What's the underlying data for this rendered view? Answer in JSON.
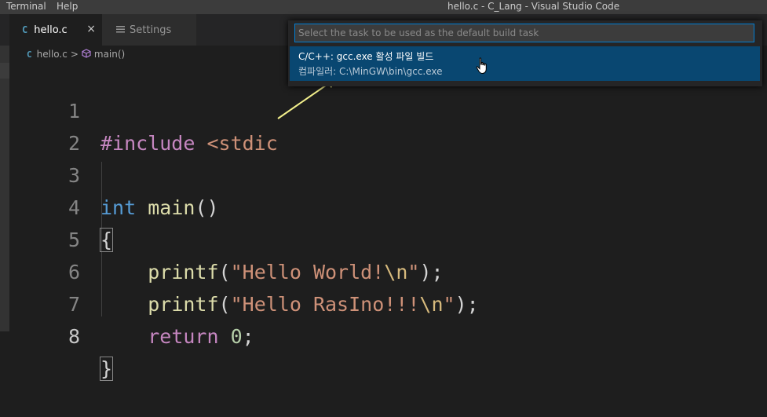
{
  "menubar": {
    "items": [
      "Terminal",
      "Help"
    ],
    "window_title": "hello.c - C_Lang - Visual Studio Code"
  },
  "tabs": [
    {
      "icon": "C",
      "label": "hello.c",
      "close": "×",
      "active": true
    },
    {
      "icon": "settings-icon",
      "label": "Settings",
      "active": false
    }
  ],
  "breadcrumb": {
    "file_icon": "C",
    "file": "hello.c",
    "separator": ">",
    "symbol_icon": "cube-icon",
    "symbol": "main()"
  },
  "editor": {
    "line_numbers": [
      "1",
      "2",
      "3",
      "4",
      "5",
      "6",
      "7",
      "8"
    ],
    "current_line": "8",
    "tokens": {
      "l1_pre": "#include",
      "l1_rest": " <stdic",
      "l3_type": "int",
      "l3_fn": "main",
      "l3_paren": "()",
      "l4_brace": "{",
      "l5_fn": "printf",
      "l5_open": "(",
      "l5_str": "\"Hello World!",
      "l5_esc": "\\n",
      "l5_strend": "\"",
      "l5_close": ");",
      "l6_fn": "printf",
      "l6_open": "(",
      "l6_str": "\"Hello RasIno!!!",
      "l6_esc": "\\n",
      "l6_strend": "\"",
      "l6_close": ");",
      "l7_kw": "return",
      "l7_num": "0",
      "l7_semi": ";",
      "l8_brace": "}"
    }
  },
  "quick_pick": {
    "placeholder": "Select the task to be used as the default build task",
    "items": [
      {
        "label": "C/C++: gcc.exe 활성 파일 빌드",
        "detail": "컴파일러: C:\\MinGW\\bin\\gcc.exe"
      }
    ]
  },
  "colors": {
    "accent_focus": "#007fd4",
    "selection": "#094771",
    "annotation_arrow": "#f3f08c"
  }
}
